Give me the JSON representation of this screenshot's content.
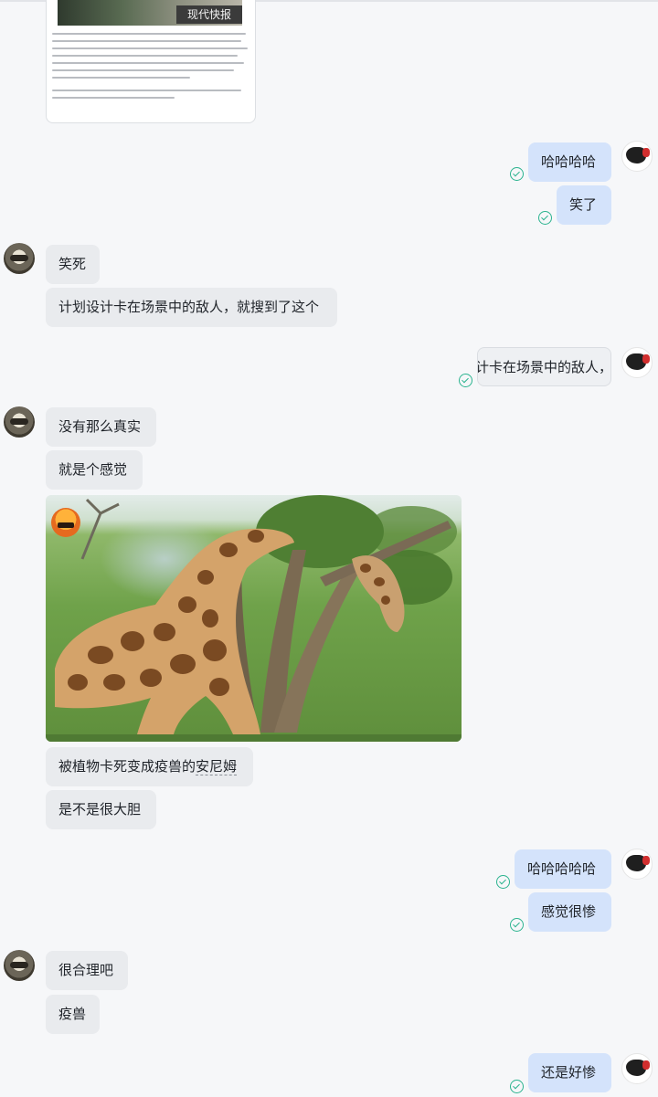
{
  "messages": [
    {
      "id": "m1",
      "side": "right",
      "text": "哈哈哈哈"
    },
    {
      "id": "m2",
      "side": "right",
      "text": "笑了"
    },
    {
      "id": "m3",
      "side": "left",
      "text": "笑死"
    },
    {
      "id": "m4",
      "side": "left",
      "text": "计划设计卡在场景中的敌人，就搜到了这个"
    },
    {
      "id": "m5",
      "side": "right",
      "text": "计卡在场景中的敌人，"
    },
    {
      "id": "m6",
      "side": "left",
      "text": "没有那么真实"
    },
    {
      "id": "m7",
      "side": "left",
      "text": "就是个感觉"
    },
    {
      "id": "m8",
      "side": "left",
      "text_before": "被植物卡死变成疫兽的",
      "text_underlined": "安尼姆"
    },
    {
      "id": "m9",
      "side": "left",
      "text": "是不是很大胆"
    },
    {
      "id": "m10",
      "side": "right",
      "text": "哈哈哈哈哈"
    },
    {
      "id": "m11",
      "side": "right",
      "text": "感觉很惨"
    },
    {
      "id": "m12",
      "side": "left",
      "text": "很合理吧"
    },
    {
      "id": "m13",
      "side": "left",
      "text": "疫兽"
    },
    {
      "id": "m14",
      "side": "right",
      "text": "还是好惨"
    }
  ],
  "newspaper_clip": {
    "masthead": "现代快报"
  },
  "avatars": {
    "left": "raccoon-avatar",
    "right": "bird-avatar"
  },
  "colors": {
    "incoming_bubble": "#e9ebee",
    "outgoing_bubble": "#d4e3fb",
    "read_check": "#2bb38f",
    "background": "#f6f7f9"
  }
}
